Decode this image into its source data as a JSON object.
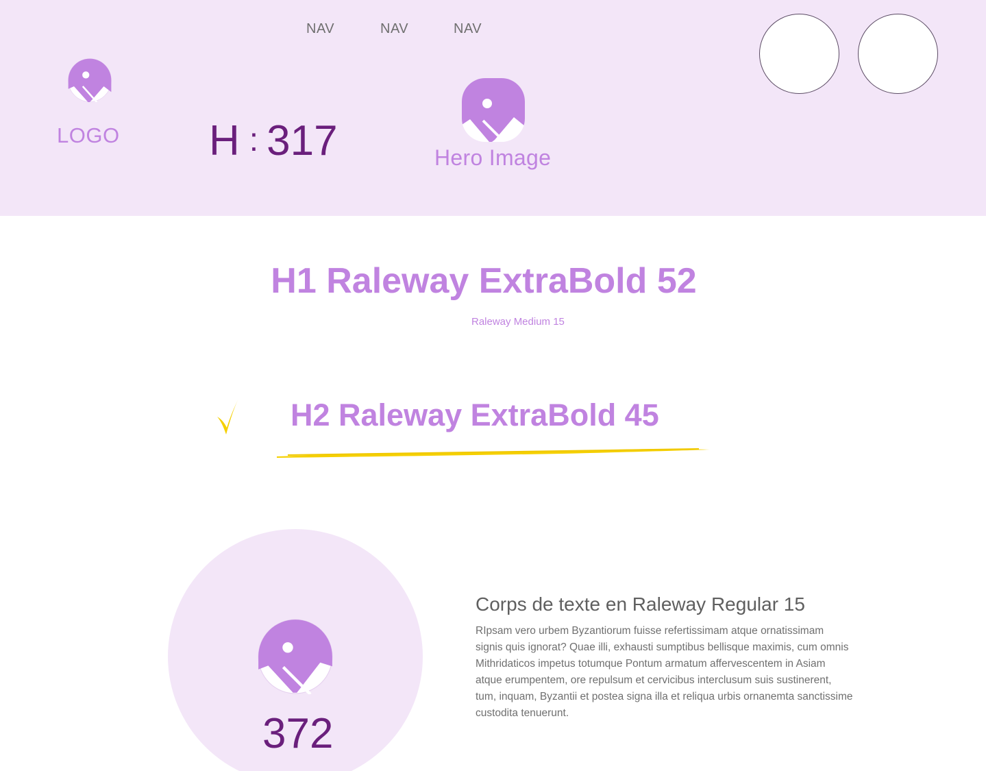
{
  "nav": {
    "items": [
      "NAV",
      "NAV",
      "NAV"
    ]
  },
  "header": {
    "logo_label": "LOGO",
    "height_label": "H",
    "height_colon": ":",
    "height_value": "317",
    "hero_label": "Hero Image"
  },
  "headings": {
    "h1": "H1 Raleway ExtraBold 52",
    "h1_sub": "Raleway Medium 15",
    "h2": "H2 Raleway ExtraBold 45"
  },
  "feature": {
    "circle_value": "372",
    "body_title": "Corps de texte en Raleway Regular 15",
    "body_text": "RIpsam vero urbem Byzantiorum fuisse refertissimam atque ornatissimam signis quis ignorat? Quae illi, exhausti sumptibus bellisque maximis, cum omnis Mithridaticos impetus totumque Pontum armatum affervescentem in Asiam atque erumpentem, ore repulsum et cervicibus interclusum suis sustinerent, tum, inquam, Byzantii et postea signa illa et reliqua urbis ornanemta sanctissime custodita tenuerunt."
  },
  "icons": {
    "image_placeholder": "image-placeholder-icon",
    "check": "check-icon",
    "underline": "brush-underline"
  },
  "colors": {
    "hero_bg": "#f3e6f8",
    "accent": "#c083e0",
    "dark_purple": "#6a1f7c",
    "highlight_yellow": "#f5d000"
  }
}
